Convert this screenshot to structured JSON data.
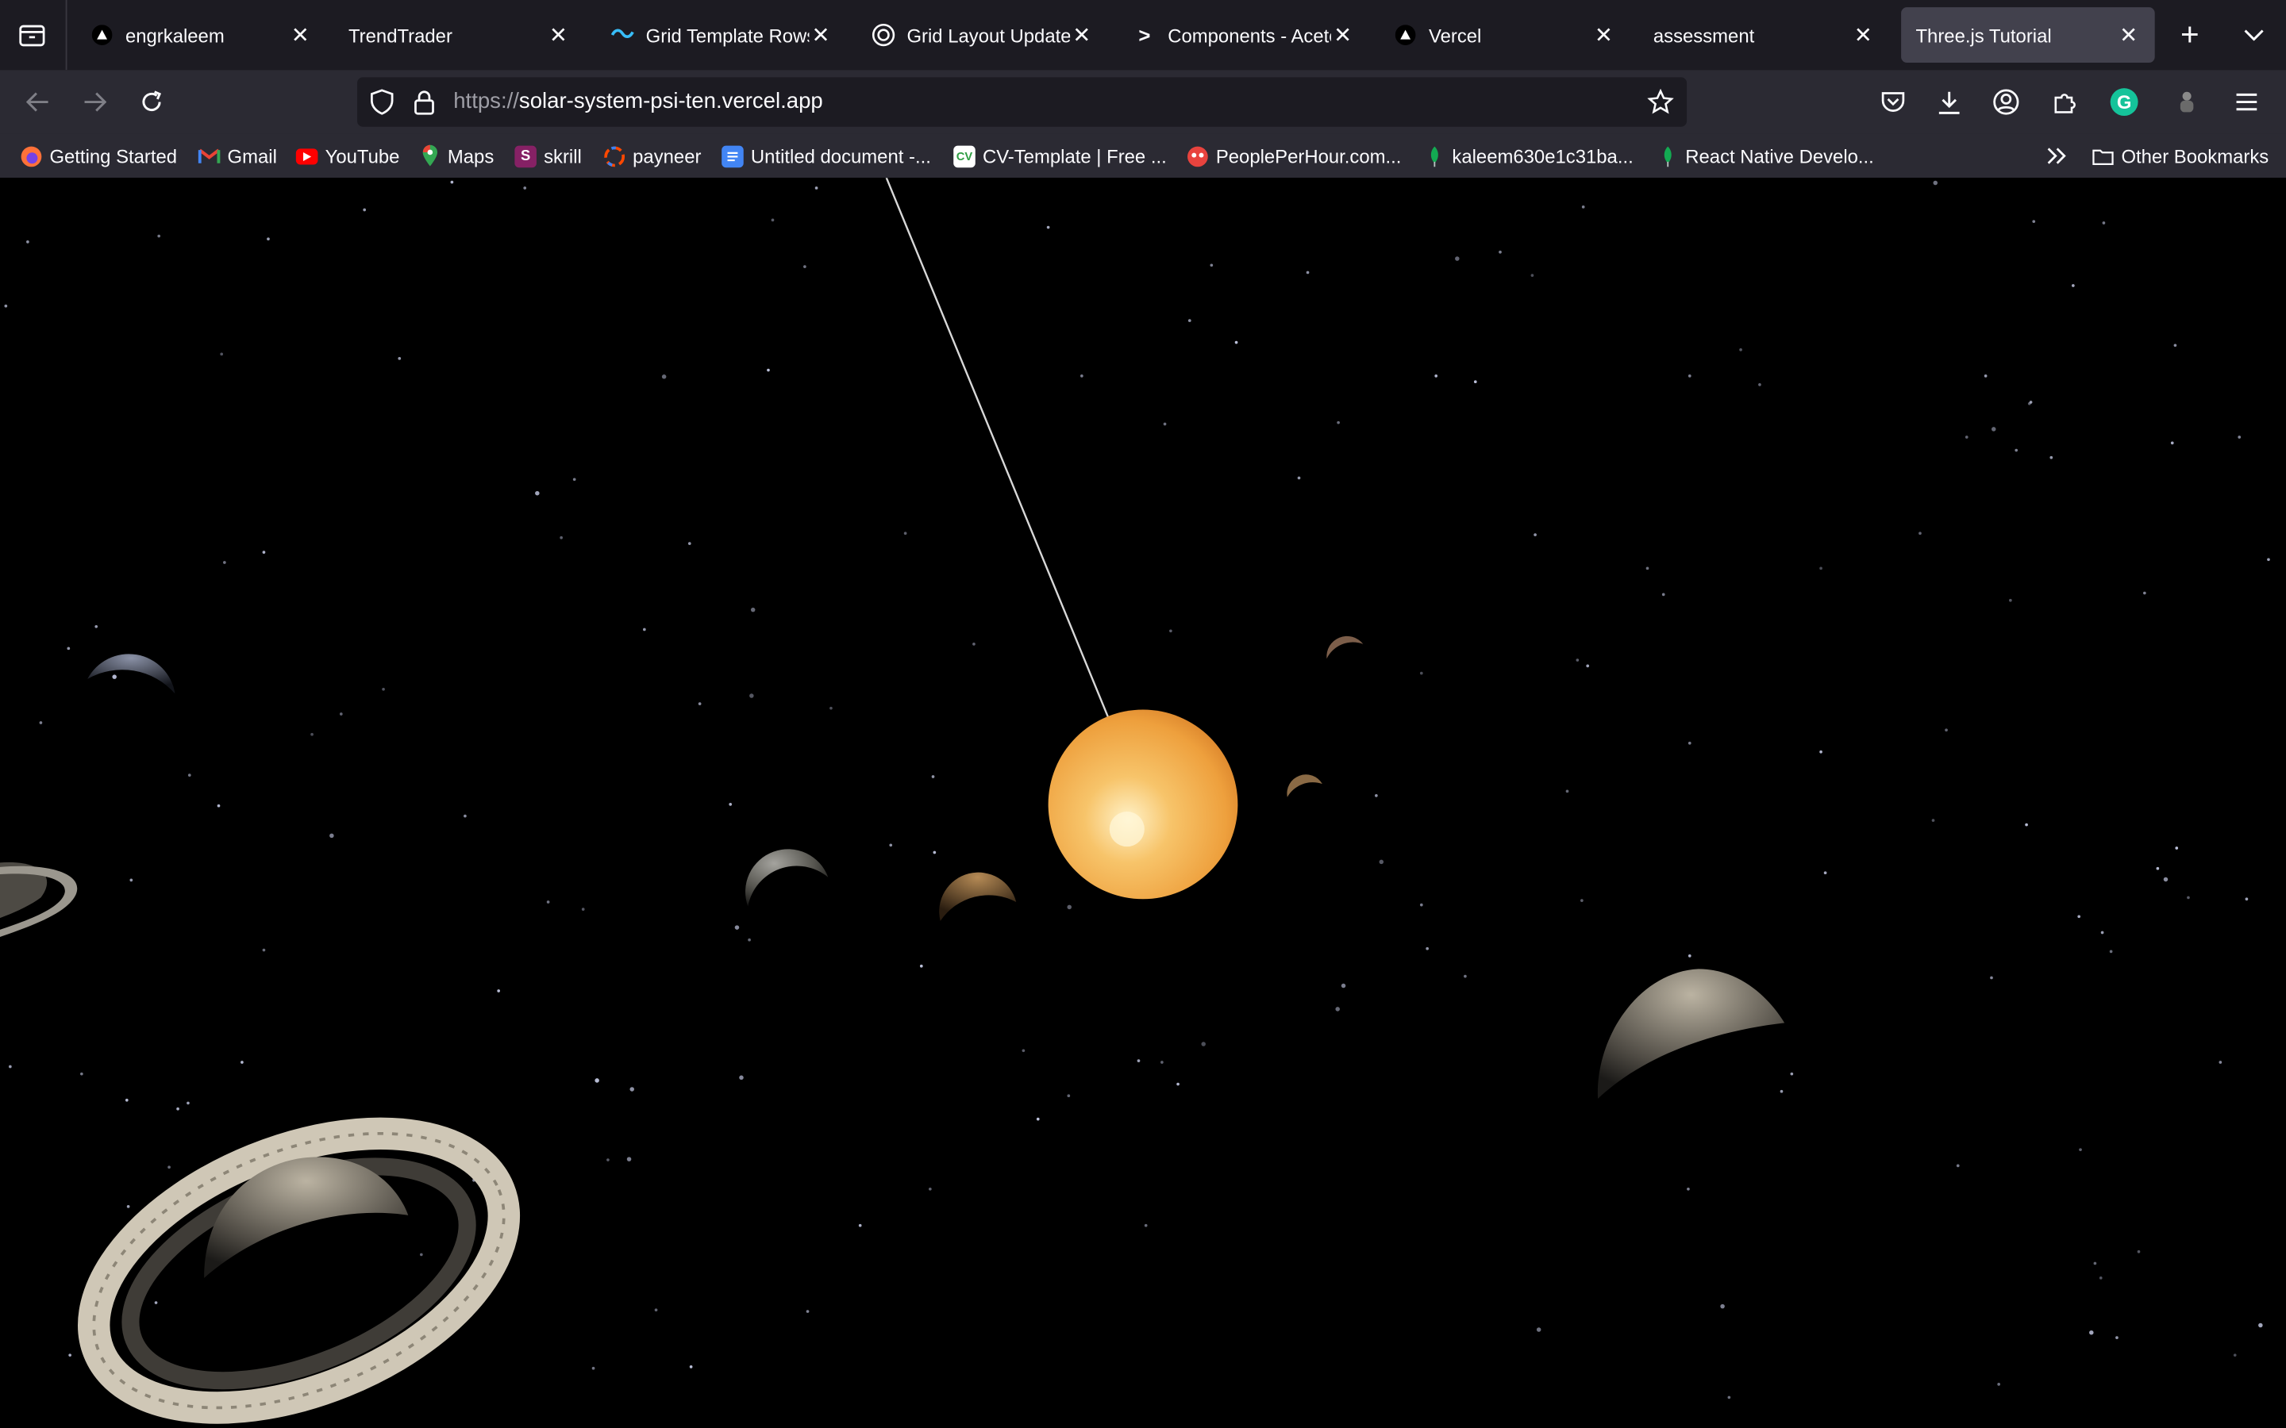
{
  "browser": {
    "tabs": [
      {
        "title": "engrkaleem",
        "icon": "vercel-triangle-icon"
      },
      {
        "title": "TrendTrader",
        "icon": ""
      },
      {
        "title": "Grid Template Rows",
        "icon": "tailwind-icon"
      },
      {
        "title": "Grid Layout Update",
        "icon": "openai-icon"
      },
      {
        "title": "Components - Aceternity",
        "icon": "aceternity-icon"
      },
      {
        "title": "Vercel",
        "icon": "vercel-triangle-icon"
      },
      {
        "title": "assessment",
        "icon": ""
      },
      {
        "title": "Three.js Tutorial",
        "icon": "",
        "active": true
      }
    ],
    "url": {
      "scheme": "https://",
      "host": "solar-system-psi-ten.vercel.app"
    },
    "bookmarks": [
      {
        "label": "Getting Started",
        "icon": "firefox-icon"
      },
      {
        "label": "Gmail",
        "icon": "gmail-icon"
      },
      {
        "label": "YouTube",
        "icon": "youtube-icon"
      },
      {
        "label": "Maps",
        "icon": "maps-pin-icon"
      },
      {
        "label": "skrill",
        "icon": "skrill-icon"
      },
      {
        "label": "payneer",
        "icon": "payoneer-icon"
      },
      {
        "label": "Untitled document -...",
        "icon": "google-docs-icon"
      },
      {
        "label": "CV-Template | Free ...",
        "icon": "cv-icon"
      },
      {
        "label": "PeoplePerHour.com...",
        "icon": "peopleperhour-icon"
      },
      {
        "label": "kaleem630e1c31ba...",
        "icon": "mongodb-leaf-icon"
      },
      {
        "label": "React Native Develo...",
        "icon": "mongodb-leaf-icon"
      }
    ],
    "other_bookmarks": "Other Bookmarks"
  },
  "colors": {
    "tabbar": "#1c1b22",
    "toolbar": "#2b2a33",
    "active_tab": "#42414d",
    "sun": "#f0a640",
    "space": "#000000"
  }
}
